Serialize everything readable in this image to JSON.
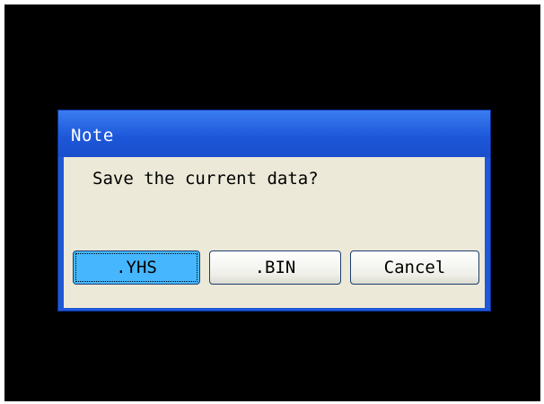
{
  "dialog": {
    "title": "Note",
    "message": "Save the current data?",
    "buttons": {
      "yhs": ".YHS",
      "bin": ".BIN",
      "cancel": "Cancel"
    }
  },
  "colors": {
    "screen_background": "#000000",
    "titlebar": "#1f59d6",
    "dialog_body": "#ece9d8",
    "focused_button": "#46b7ff"
  }
}
